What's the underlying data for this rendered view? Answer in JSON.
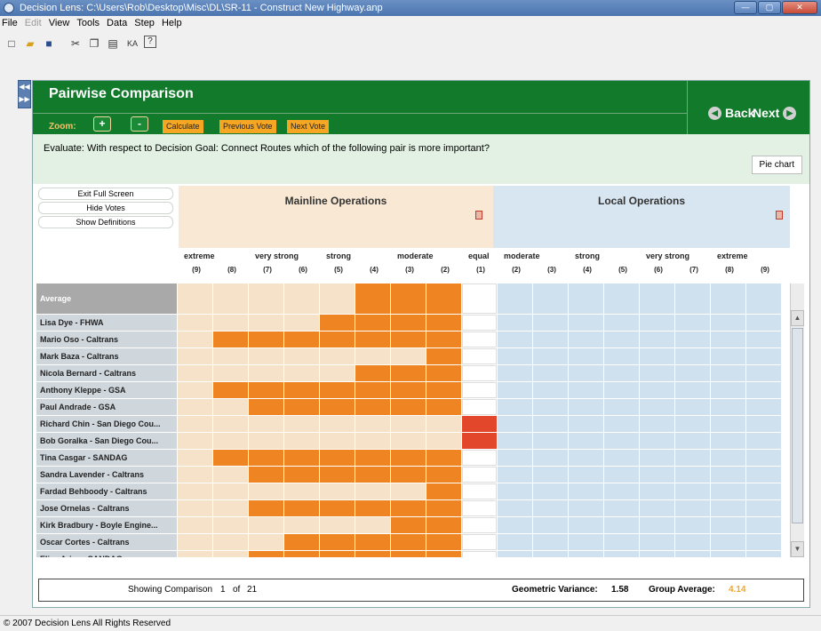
{
  "window": {
    "title": "Decision Lens: C:\\Users\\Rob\\Desktop\\Misc\\DL\\SR-11 - Construct New Highway.anp"
  },
  "menu": [
    "File",
    "Edit",
    "View",
    "Tools",
    "Data",
    "Step",
    "Help"
  ],
  "toolbar": {
    "ka_label": "KA"
  },
  "page": {
    "title": "Pairwise Comparison",
    "zoom_label": "Zoom:",
    "zoom_in": "+",
    "zoom_out": "-",
    "calculate": "Calculate",
    "previous_vote": "Previous Vote",
    "next_vote": "Next Vote",
    "back": "Back",
    "next": "Next"
  },
  "question": "Evaluate: With respect to Decision Goal: Connect Routes which of the following pair is more important?",
  "pie_chart": "Pie chart",
  "side_buttons": [
    "Exit Full Screen",
    "Hide Votes",
    "Show Definitions"
  ],
  "left_option": "Mainline Operations",
  "right_option": "Local Operations",
  "scale_labels": [
    {
      "text": "extreme",
      "col": 0
    },
    {
      "text": "very strong",
      "col": 2
    },
    {
      "text": "strong",
      "col": 4
    },
    {
      "text": "moderate",
      "col": 6
    },
    {
      "text": "equal",
      "col": 8
    },
    {
      "text": "moderate",
      "col": 9
    },
    {
      "text": "strong",
      "col": 11
    },
    {
      "text": "very strong",
      "col": 13
    },
    {
      "text": "extreme",
      "col": 15
    }
  ],
  "scale_numbers": [
    "(9)",
    "(8)",
    "(7)",
    "(6)",
    "(5)",
    "(4)",
    "(3)",
    "(2)",
    "(1)",
    "(2)",
    "(3)",
    "(4)",
    "(5)",
    "(6)",
    "(7)",
    "(8)",
    "(9)"
  ],
  "rows": [
    {
      "name": "Average",
      "filled_from": 5,
      "average": true
    },
    {
      "name": "Lisa Dye - FHWA",
      "filled_from": 4
    },
    {
      "name": "Mario Oso - Caltrans",
      "filled_from": 1
    },
    {
      "name": "Mark Baza - Caltrans",
      "filled_from": 7
    },
    {
      "name": "Nicola Bernard - Caltrans",
      "filled_from": 5
    },
    {
      "name": "Anthony Kleppe - GSA",
      "filled_from": 1
    },
    {
      "name": "Paul Andrade - GSA",
      "filled_from": 2
    },
    {
      "name": "Richard Chin - San Diego Cou...",
      "filled_from": 8,
      "red": true
    },
    {
      "name": "Bob Goralka - San Diego Cou...",
      "filled_from": 8,
      "red": true
    },
    {
      "name": "Tina Casgar - SANDAG",
      "filled_from": 1
    },
    {
      "name": "Sandra Lavender - Caltrans",
      "filled_from": 2
    },
    {
      "name": "Fardad Behboody - Caltrans",
      "filled_from": 7
    },
    {
      "name": "Jose Ornelas - Caltrans",
      "filled_from": 2
    },
    {
      "name": "Kirk Bradbury - Boyle Engine...",
      "filled_from": 6
    },
    {
      "name": "Oscar Cortes - Caltrans",
      "filled_from": 3
    },
    {
      "name": "Elisa Arias - SANDAG",
      "filled_from": 2
    }
  ],
  "status": {
    "showing_label": "Showing Comparison",
    "current": "1",
    "of_label": "of",
    "total": "21",
    "variance_label": "Geometric Variance:",
    "variance_value": "1.58",
    "group_avg_label": "Group Average:",
    "group_avg_value": "4.14"
  },
  "footer": "© 2007 Decision Lens All Rights Reserved",
  "colors": {
    "header_green": "#117a2b",
    "vote_orange": "#ee8522",
    "tie_red": "#e2472b",
    "left_bg": "#f9e9d4",
    "right_bg": "#d8e6f1"
  }
}
